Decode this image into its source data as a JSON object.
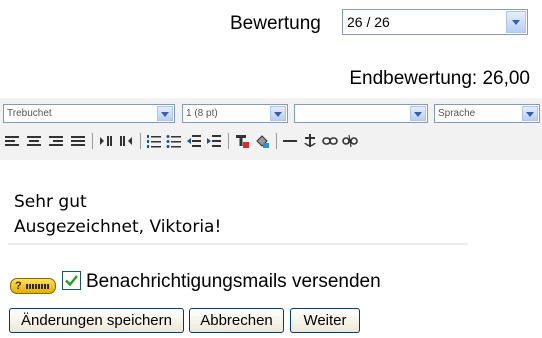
{
  "grade": {
    "label": "Bewertung",
    "selected": "26 / 26",
    "final": "Endbewertung: 26,00"
  },
  "editor": {
    "font_family": "Trebuchet",
    "font_size": "1 (8 pt)",
    "paragraph": "",
    "language": "Sprache",
    "toolbar_icons": [
      "align-left-icon",
      "align-center-icon",
      "align-right-icon",
      "align-justify-icon",
      "ltr-icon",
      "rtl-icon",
      "ordered-list-icon",
      "unordered-list-icon",
      "outdent-icon",
      "indent-icon",
      "text-color-icon",
      "background-color-icon",
      "horizontal-rule-icon",
      "anchor-icon",
      "link-icon",
      "unlink-icon"
    ]
  },
  "comment": {
    "line1": "Sehr gut",
    "line2": "Ausgezeichnet, Viktoria!"
  },
  "notification": {
    "help_icon": "help-icon",
    "checked": true,
    "label": "Benachrichtigungsmails versenden"
  },
  "buttons": {
    "save": "Änderungen speichern",
    "cancel": "Abbrechen",
    "next": "Weiter"
  },
  "colors": {
    "field_border": "#7f9db9",
    "button_border": "#003c74",
    "toolbar_bg": "#f2f2f2",
    "check_mark": "#21a121"
  }
}
